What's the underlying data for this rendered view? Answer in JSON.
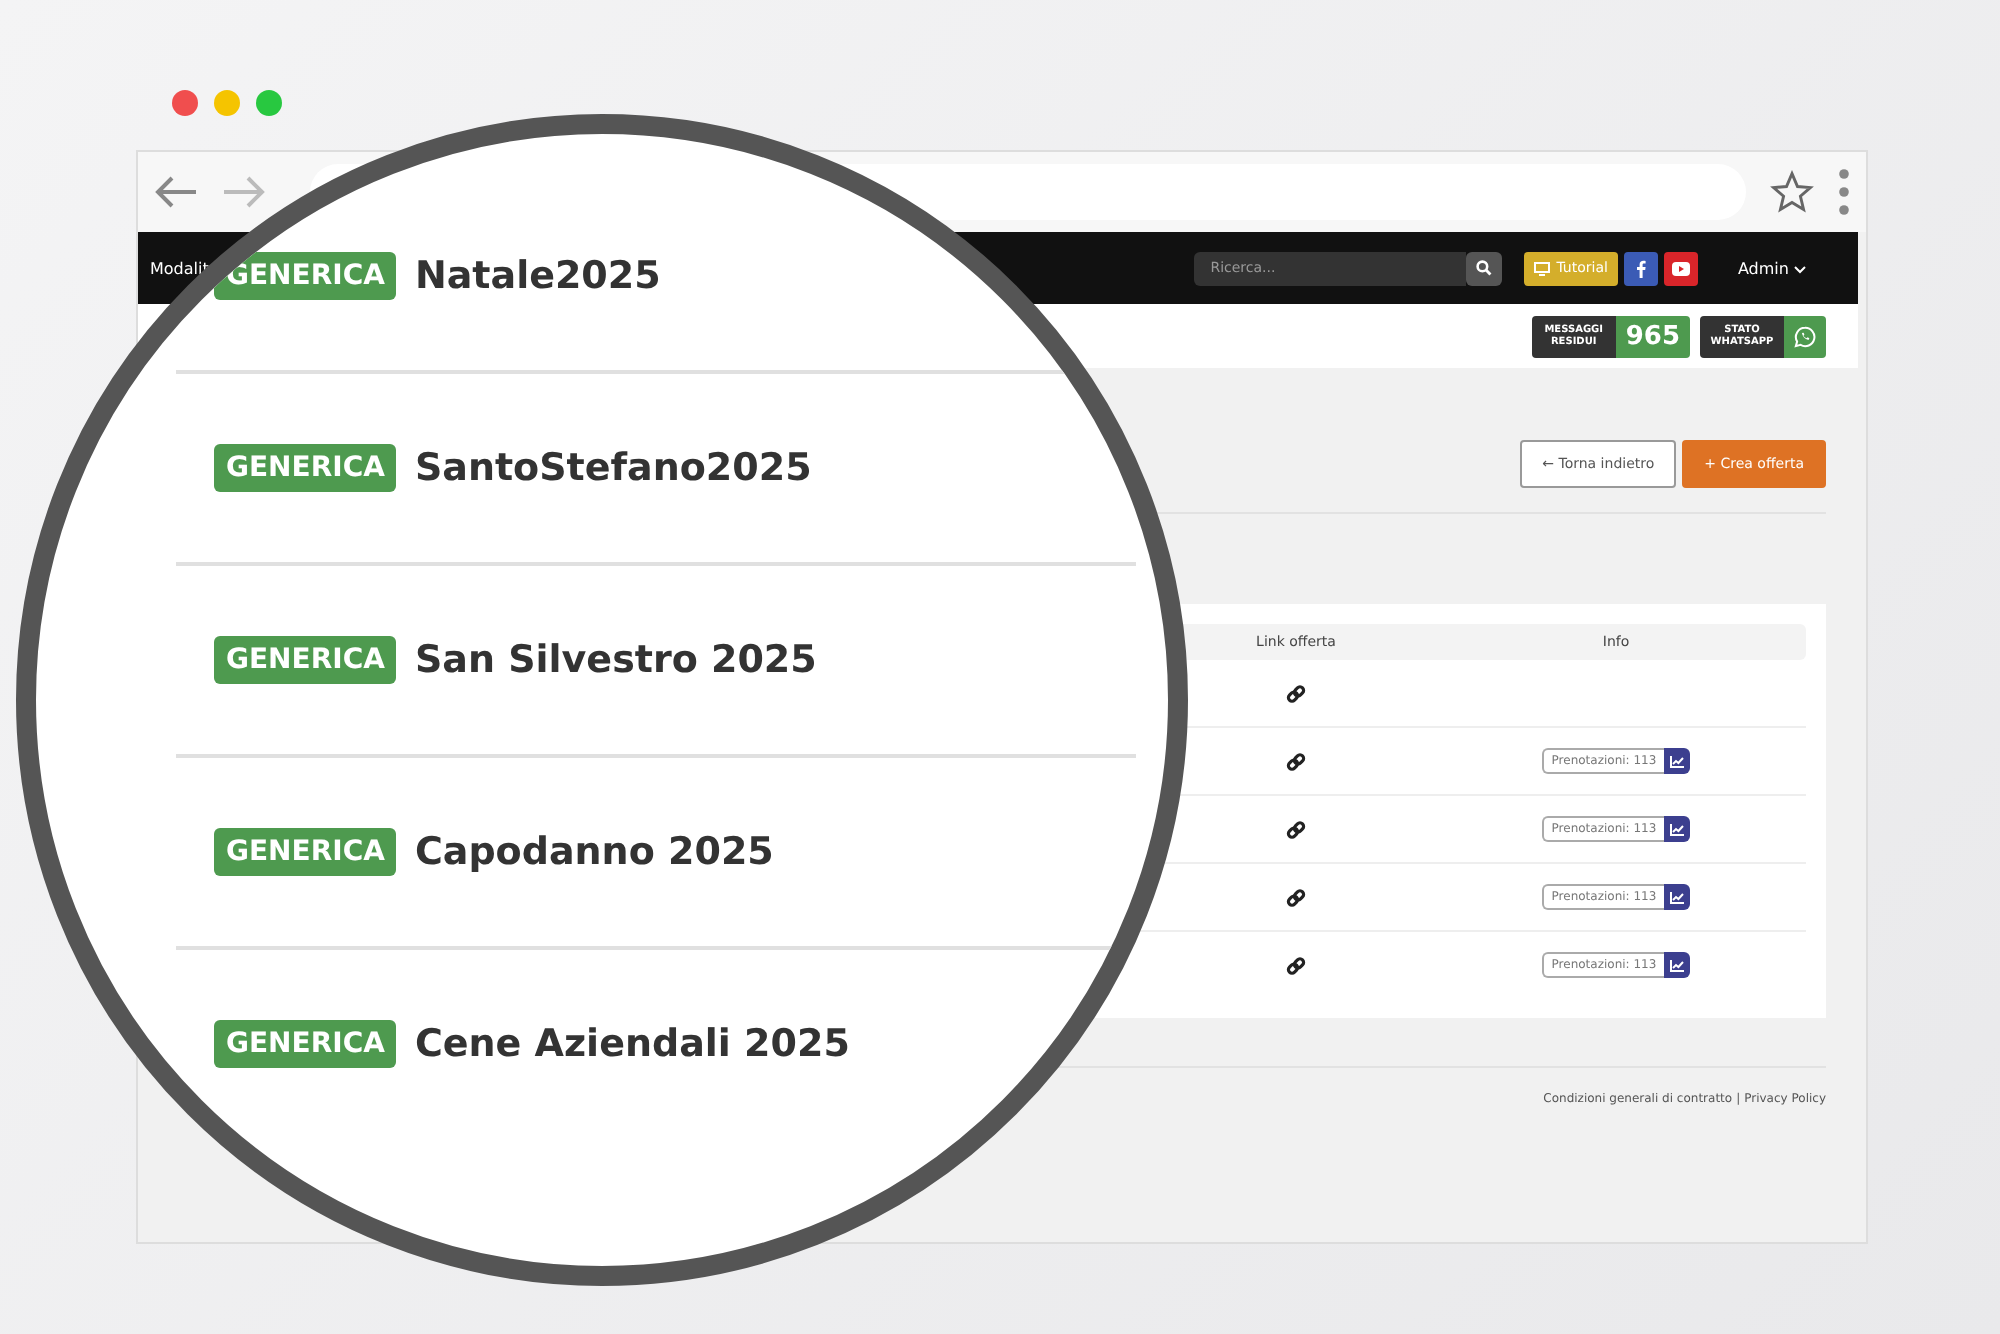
{
  "nav": {
    "menu_item": "Modalit",
    "search": {
      "placeholder": "Ricerca..."
    },
    "tutorial_button": "Tutorial",
    "user_menu": "Admin"
  },
  "status": {
    "messages": {
      "label": "MESSAGGI RESIDUI",
      "value": "965"
    },
    "whatsapp": {
      "label": "STATO WHATSAPP"
    }
  },
  "actions": [
    {
      "label": "← Torna indietro",
      "kind": "secondary"
    },
    {
      "label": "+ Crea offerta",
      "kind": "primary"
    }
  ],
  "table": {
    "columns": [
      "Link offerta",
      "Info"
    ],
    "rows": [
      {
        "info": null
      },
      {
        "info": "Prenotazioni: 113"
      },
      {
        "info": "Prenotazioni: 113"
      },
      {
        "info": "Prenotazioni: 113"
      },
      {
        "info": "Prenotazioni: 113"
      }
    ]
  },
  "footer": {
    "terms_link": "Condizioni generali di contratto",
    "separator": "|",
    "privacy_link": "Privacy Policy"
  },
  "magnifier": {
    "offers": [
      {
        "tag": "GENERICA",
        "name": "Natale2025"
      },
      {
        "tag": "GENERICA",
        "name": "SantoStefano2025"
      },
      {
        "tag": "GENERICA",
        "name": "San Silvestro 2025"
      },
      {
        "tag": "GENERICA",
        "name": "Capodanno 2025"
      },
      {
        "tag": "GENERICA",
        "name": "Cene Aziendali 2025"
      }
    ]
  }
}
